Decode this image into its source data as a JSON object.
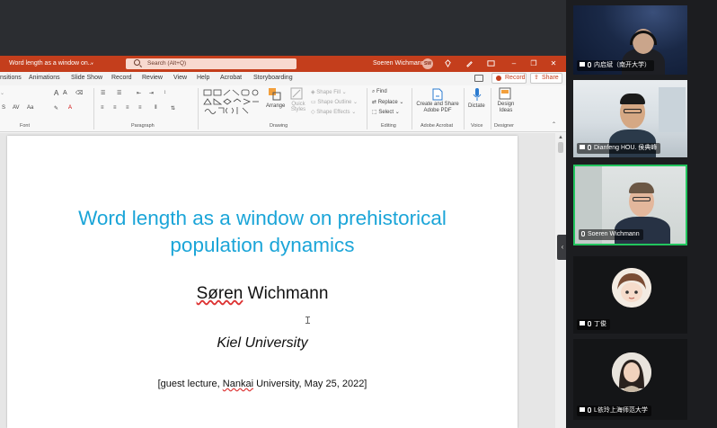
{
  "window": {
    "doc_title": "Word length as a window on...",
    "search_placeholder": "Search (Alt+Q)",
    "user_name": "Soeren Wichmann",
    "user_initials": "SW"
  },
  "ribbon": {
    "tabs": [
      "nsitions",
      "Animations",
      "Slide Show",
      "Record",
      "Review",
      "View",
      "Help",
      "Acrobat",
      "Storyboarding"
    ],
    "record_label": "Record",
    "share_label": "Share",
    "groups": {
      "font": "Font",
      "paragraph": "Paragraph",
      "drawing": "Drawing",
      "editing": "Editing",
      "adobe": "Adobe Acrobat",
      "voice": "Voice",
      "designer": "Designer"
    },
    "buttons": {
      "arrange": "Arrange",
      "quick_styles": "Quick Styles",
      "shape_fill": "Shape Fill",
      "shape_outline": "Shape Outline",
      "shape_effects": "Shape Effects",
      "find": "Find",
      "replace": "Replace",
      "select": "Select",
      "create_share": "Create and Share",
      "adobe_pdf": "Adobe PDF",
      "dictate": "Dictate",
      "design": "Design",
      "ideas": "Ideas"
    }
  },
  "slide": {
    "title_line1": "Word length as a window on prehistorical",
    "title_line2": "population dynamics",
    "author_first": "Søren",
    "author_last": " Wichmann",
    "affiliation": "Kiel University",
    "note_pre": "[guest lecture, ",
    "note_nankai": "Nankai",
    "note_post": " University, May 25, 2022]"
  },
  "participants": [
    {
      "name": "内启斌（南开大学）"
    },
    {
      "name": "Dianfeng HOU. 侯典峰"
    },
    {
      "name": "Soeren Wichmann"
    },
    {
      "name": "丁俊"
    },
    {
      "name": "L依玲上海师范大学"
    }
  ],
  "colors": {
    "ppt_accent": "#c43e1c",
    "slide_title": "#1ba5d8",
    "active_speaker": "#22c55e"
  }
}
